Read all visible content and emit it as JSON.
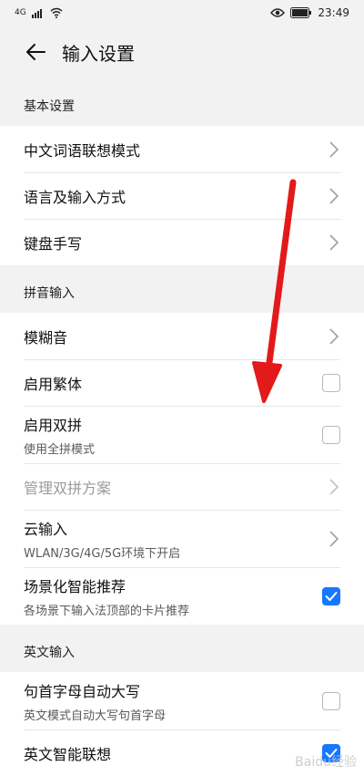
{
  "status_bar": {
    "signal_label": "4G",
    "time": "23:49"
  },
  "app_bar": {
    "title": "输入设置"
  },
  "sections": [
    {
      "header": "基本设置",
      "rows": [
        {
          "label": "中文词语联想模式",
          "type": "chevron"
        },
        {
          "label": "语言及输入方式",
          "type": "chevron"
        },
        {
          "label": "键盘手写",
          "type": "chevron"
        }
      ]
    },
    {
      "header": "拼音输入",
      "rows": [
        {
          "label": "模糊音",
          "type": "chevron"
        },
        {
          "label": "启用繁体",
          "type": "checkbox",
          "checked": false
        },
        {
          "label": "启用双拼",
          "sub": "使用全拼模式",
          "type": "checkbox",
          "checked": false
        },
        {
          "label": "管理双拼方案",
          "type": "chevron",
          "disabled": true
        },
        {
          "label": "云输入",
          "sub": "WLAN/3G/4G/5G环境下开启",
          "type": "chevron"
        },
        {
          "label": "场景化智能推荐",
          "sub": "各场景下输入法顶部的卡片推荐",
          "type": "checkbox",
          "checked": true
        }
      ]
    },
    {
      "header": "英文输入",
      "rows": [
        {
          "label": "句首字母自动大写",
          "sub": "英文模式自动大写句首字母",
          "type": "checkbox",
          "checked": false
        },
        {
          "label": "英文智能联想",
          "type": "checkbox",
          "checked": true
        }
      ]
    }
  ],
  "colors": {
    "accent": "#1677ff",
    "annotation_arrow": "#e21a1a"
  },
  "watermark": {
    "text": "Baidu经验"
  }
}
